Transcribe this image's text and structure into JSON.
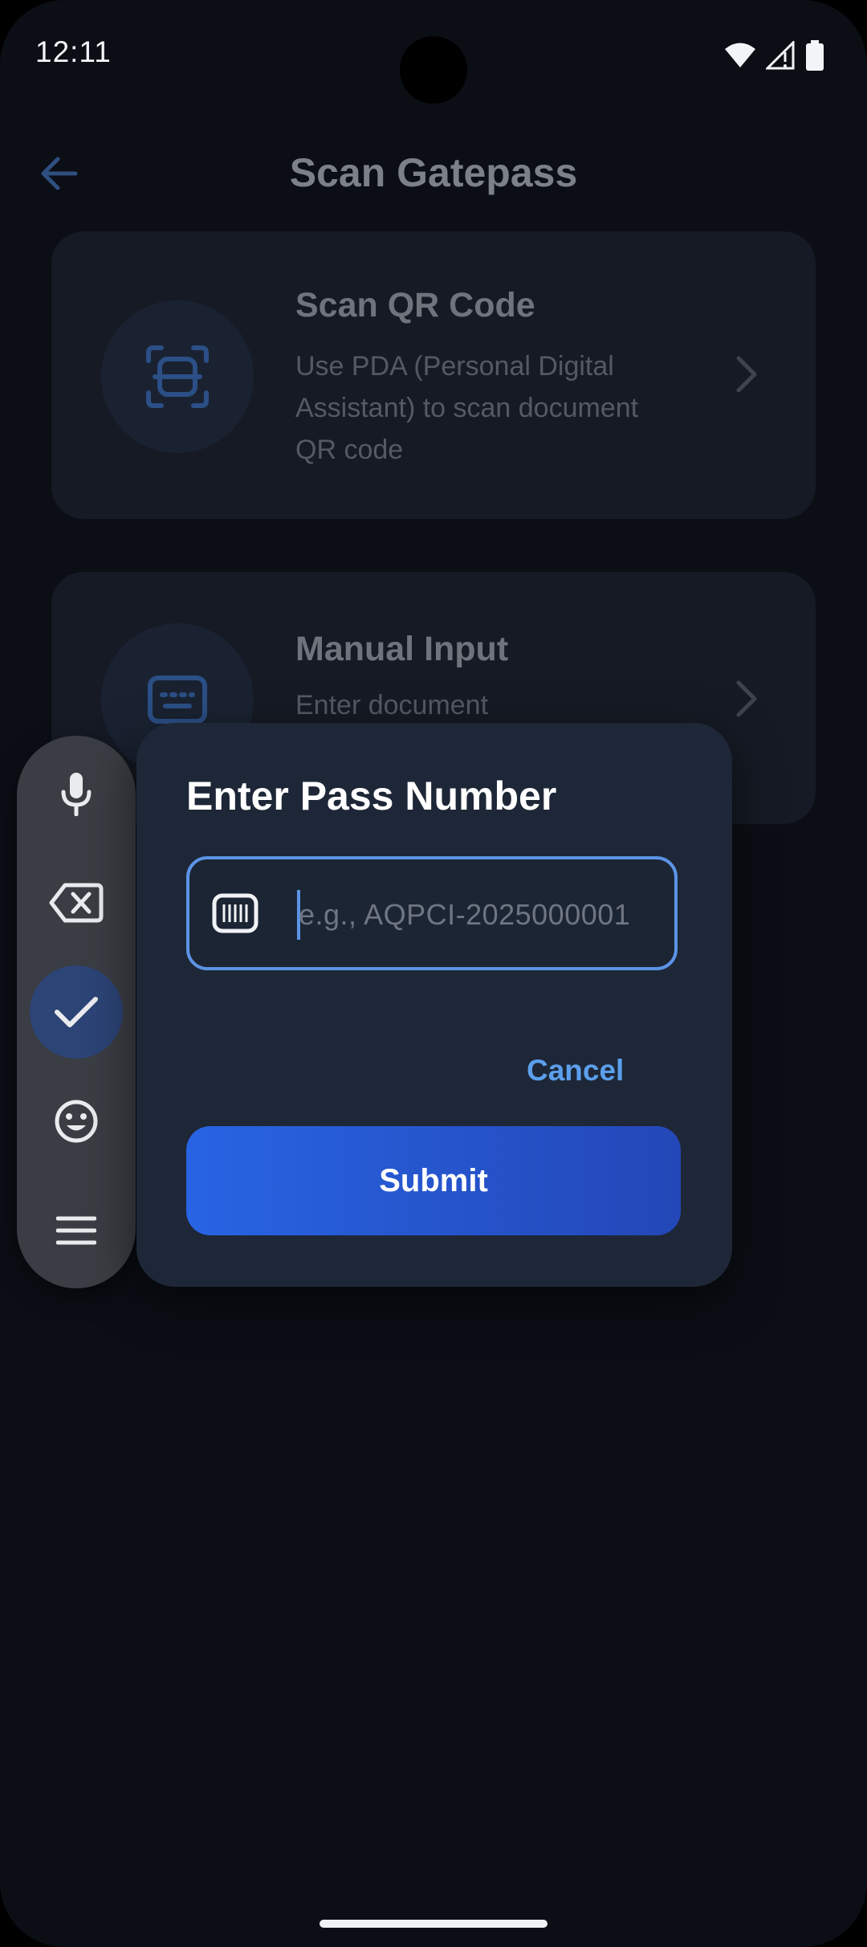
{
  "status_bar": {
    "time": "12:11",
    "icons": [
      "wifi-icon",
      "signal-icon",
      "battery-icon"
    ]
  },
  "header": {
    "title": "Scan Gatepass",
    "back_icon": "arrow-left-icon"
  },
  "options": [
    {
      "title": "Scan QR Code",
      "description": "Use PDA (Personal Digital Assistant) to scan document QR code",
      "icon": "qr-scan-icon"
    },
    {
      "title": "Manual Input",
      "description": "Enter document",
      "icon": "keyboard-icon"
    }
  ],
  "dialog": {
    "title": "Enter Pass Number",
    "input": {
      "value": "",
      "placeholder": "e.g., AQPCI-2025000001",
      "icon": "barcode-icon"
    },
    "cancel_label": "Cancel",
    "submit_label": "Submit"
  },
  "keyboard_toolbar": {
    "buttons": [
      "microphone-icon",
      "backspace-icon",
      "checkmark-icon",
      "emoji-icon",
      "menu-icon"
    ]
  },
  "colors": {
    "background": "#0b0e15",
    "dialog": "#1e2737",
    "accent": "#5b94e6",
    "submit_start": "#2864e3",
    "submit_end": "#2347b7"
  }
}
